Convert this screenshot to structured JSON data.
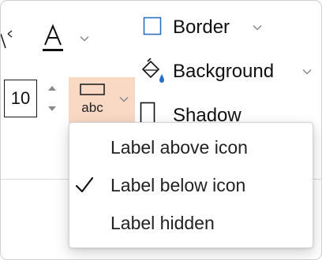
{
  "ribbon": {
    "font_size_value": "10",
    "label_position_icon_text": "abc",
    "border_label": "Border",
    "background_label": "Background",
    "shadow_label": "Shadow",
    "accent_highlight": "#f9d9c4",
    "accent_blue": "#2a70c2"
  },
  "menu": {
    "items": [
      {
        "label": "Label above icon",
        "checked": false
      },
      {
        "label": "Label below icon",
        "checked": true
      },
      {
        "label": "Label hidden",
        "checked": false
      }
    ]
  }
}
